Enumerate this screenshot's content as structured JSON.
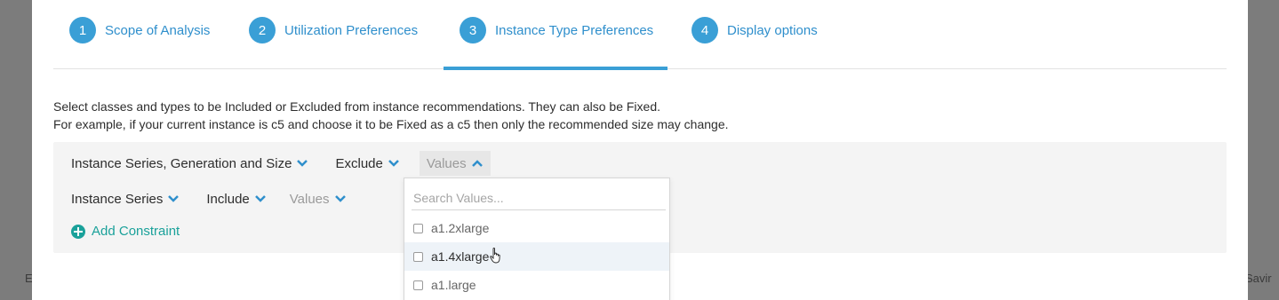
{
  "backdrop": {
    "left_text": "E",
    "right_text": "Savir"
  },
  "stepper": {
    "steps": [
      {
        "num": "1",
        "label": "Scope of Analysis"
      },
      {
        "num": "2",
        "label": "Utilization Preferences"
      },
      {
        "num": "3",
        "label": "Instance Type Preferences"
      },
      {
        "num": "4",
        "label": "Display options"
      }
    ],
    "active_index": 2
  },
  "description": {
    "line1": "Select classes and types to be Included or Excluded from instance recommendations. They can also be Fixed.",
    "line2": "For example, if your current instance is c5 and choose it to be Fixed as a c5 then only the recommended size may change."
  },
  "constraints": [
    {
      "field": "Instance Series, Generation and Size",
      "operator": "Exclude",
      "values": "Values"
    },
    {
      "field": "Instance Series",
      "operator": "Include",
      "values": "Values"
    }
  ],
  "add_constraint_label": "Add Constraint",
  "values_dropdown": {
    "search_placeholder": "Search Values...",
    "options": [
      "a1.2xlarge",
      "a1.4xlarge",
      "a1.large"
    ],
    "hovered": "a1.4xlarge"
  },
  "colors": {
    "accent": "#3a9fd6",
    "link": "#2f8fcc",
    "add": "#1aa19a",
    "panel": "#f4f4f4"
  },
  "icons": [
    "chevron-down-icon",
    "chevron-up-icon",
    "plus-circle-icon",
    "hand-cursor-icon",
    "checkbox-icon"
  ]
}
